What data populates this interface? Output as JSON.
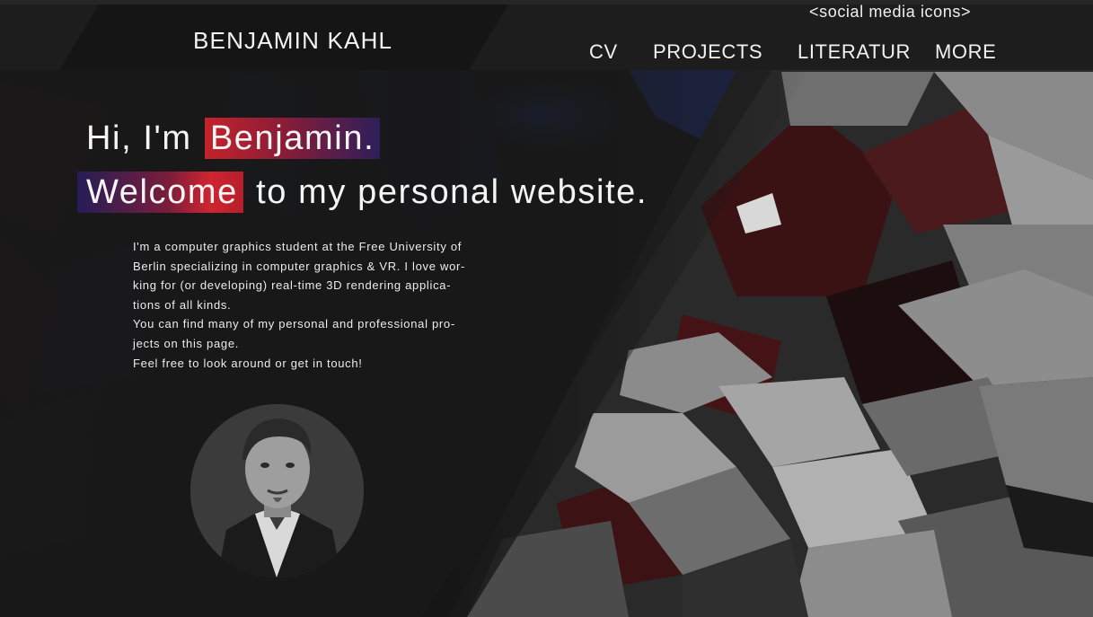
{
  "header": {
    "brand": "BENJAMIN KAHL",
    "social_placeholder": "<social media icons>",
    "nav": [
      {
        "label": "CV"
      },
      {
        "label": "PROJECTS"
      },
      {
        "label": "LITERATUR"
      },
      {
        "label": "MORE"
      }
    ]
  },
  "hero": {
    "line1_prefix": "Hi, I'm",
    "line1_highlight": "Benjamin.",
    "line2_highlight": "Welcome",
    "line2_suffix": "to my personal website."
  },
  "intro": {
    "lines": [
      "I'm a computer graphics student at the Free University of",
      "Berlin specializing in computer graphics & VR. I love wor-",
      "king for (or developing) real-time 3D rendering applica-",
      "tions of all kinds.",
      "You can find many of my personal and professional pro-",
      "jects on this page.",
      "Feel free to look around or get in touch!"
    ]
  },
  "colors": {
    "accent_red": "#cf2530",
    "accent_blue": "#2c1f5a",
    "background": "#1a1a1a"
  }
}
